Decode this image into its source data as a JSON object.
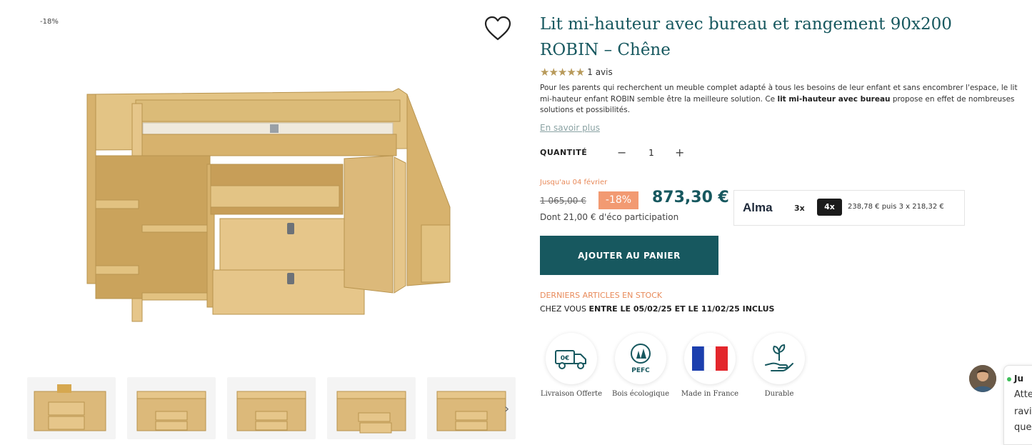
{
  "gallery": {
    "discount_badge": "-18%",
    "main_image_icon": "loft-bed-desk-image",
    "thumbnails": [
      "thumb-1",
      "thumb-2",
      "thumb-3",
      "thumb-4",
      "thumb-5"
    ],
    "prev_icon": "‹",
    "next_icon": "›"
  },
  "product": {
    "title": "Lit mi-hauteur avec bureau et rangement 90x200 ROBIN – Chêne",
    "stars": "★★★★★",
    "reviews": "1 avis",
    "desc_part1": "Pour les parents qui recherchent un meuble complet adapté à tous les besoins de leur enfant et sans encombrer l'espace, le lit mi-hauteur enfant ROBIN semble être la meilleure solution. Ce ",
    "desc_bold": "lit mi-hauteur avec bureau",
    "desc_part2": " propose en effet de nombreuses solutions et possibilités.",
    "read_more": "En savoir plus"
  },
  "quantity": {
    "label": "QUANTITÉ",
    "minus": "−",
    "value": "1",
    "plus": "+"
  },
  "pricing": {
    "until": "Jusqu'au 04 février",
    "old_price": "1 065,00 €",
    "discount": "-18%",
    "price": "873,30 €",
    "eco": "Dont 21,00 € d'éco participation"
  },
  "alma": {
    "logo": "Alma",
    "opt_3x": "3x",
    "opt_4x": "4x",
    "installments": "238,78 € puis 3 x 218,32 €"
  },
  "cart": {
    "label": "AJOUTER AU PANIER"
  },
  "stock": {
    "status": "DERNIERS ARTICLES EN STOCK",
    "delivery_prefix": "CHEZ VOUS ",
    "delivery_dates": "ENTRE LE 05/02/25 ET LE 11/02/25 INCLUS"
  },
  "features": [
    {
      "label": "Livraison Offerte",
      "icon": "delivery-truck-icon",
      "icon_text": "0€"
    },
    {
      "label": "Bois écologique",
      "icon": "pefc-icon",
      "icon_text": "PEFC"
    },
    {
      "label": "Made in France",
      "icon": "france-flag-icon"
    },
    {
      "label": "Durable",
      "icon": "plant-hand-icon"
    }
  ],
  "chat": {
    "name": "Ju",
    "line1": "Atte",
    "line2": "ravi",
    "line3": "que"
  },
  "colors": {
    "accent": "#17585f",
    "discount": "#f29a72",
    "notice": "#e88a5a",
    "star": "#b89a5b",
    "wood": "#d9b776"
  }
}
